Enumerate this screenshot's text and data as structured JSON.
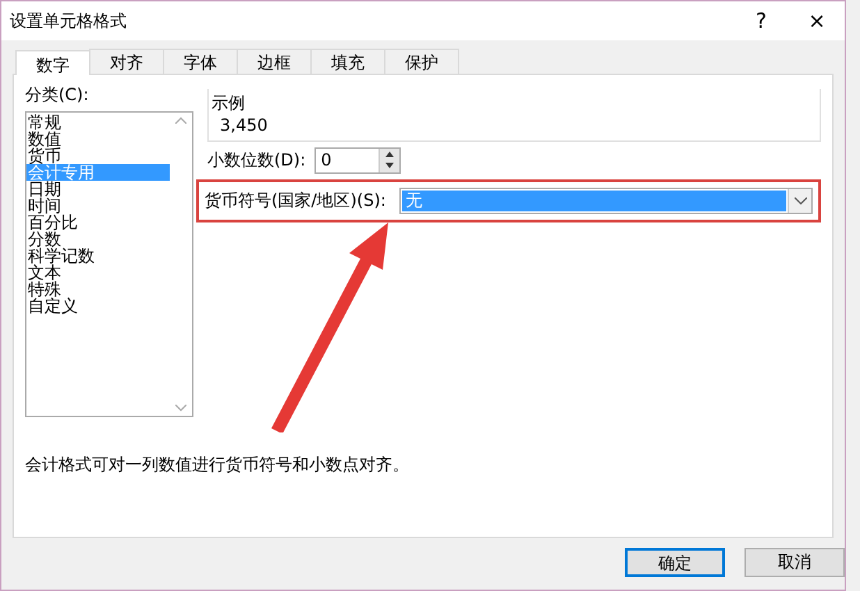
{
  "window": {
    "title": "设置单元格格式",
    "help": "?",
    "close": "×"
  },
  "tabs": [
    {
      "label": "数字",
      "selected": true
    },
    {
      "label": "对齐",
      "selected": false
    },
    {
      "label": "字体",
      "selected": false
    },
    {
      "label": "边框",
      "selected": false
    },
    {
      "label": "填充",
      "selected": false
    },
    {
      "label": "保护",
      "selected": false
    }
  ],
  "category": {
    "label": "分类(C):",
    "items": [
      {
        "label": "常规",
        "selected": false
      },
      {
        "label": "数值",
        "selected": false
      },
      {
        "label": "货币",
        "selected": false
      },
      {
        "label": "会计专用",
        "selected": true
      },
      {
        "label": "日期",
        "selected": false
      },
      {
        "label": "时间",
        "selected": false
      },
      {
        "label": "百分比",
        "selected": false
      },
      {
        "label": "分数",
        "selected": false
      },
      {
        "label": "科学记数",
        "selected": false
      },
      {
        "label": "文本",
        "selected": false
      },
      {
        "label": "特殊",
        "selected": false
      },
      {
        "label": "自定义",
        "selected": false
      }
    ]
  },
  "sample": {
    "label": "示例",
    "value": "3,450"
  },
  "decimal_places": {
    "label": "小数位数(D):",
    "value": "0"
  },
  "currency_symbol": {
    "label": "货币符号(国家/地区)(S):",
    "value": "无",
    "highlighted": true
  },
  "description": "会计格式可对一列数值进行货币符号和小数点对齐。",
  "buttons": [
    {
      "label": "确定",
      "default": true
    },
    {
      "label": "取消",
      "default": false
    }
  ]
}
